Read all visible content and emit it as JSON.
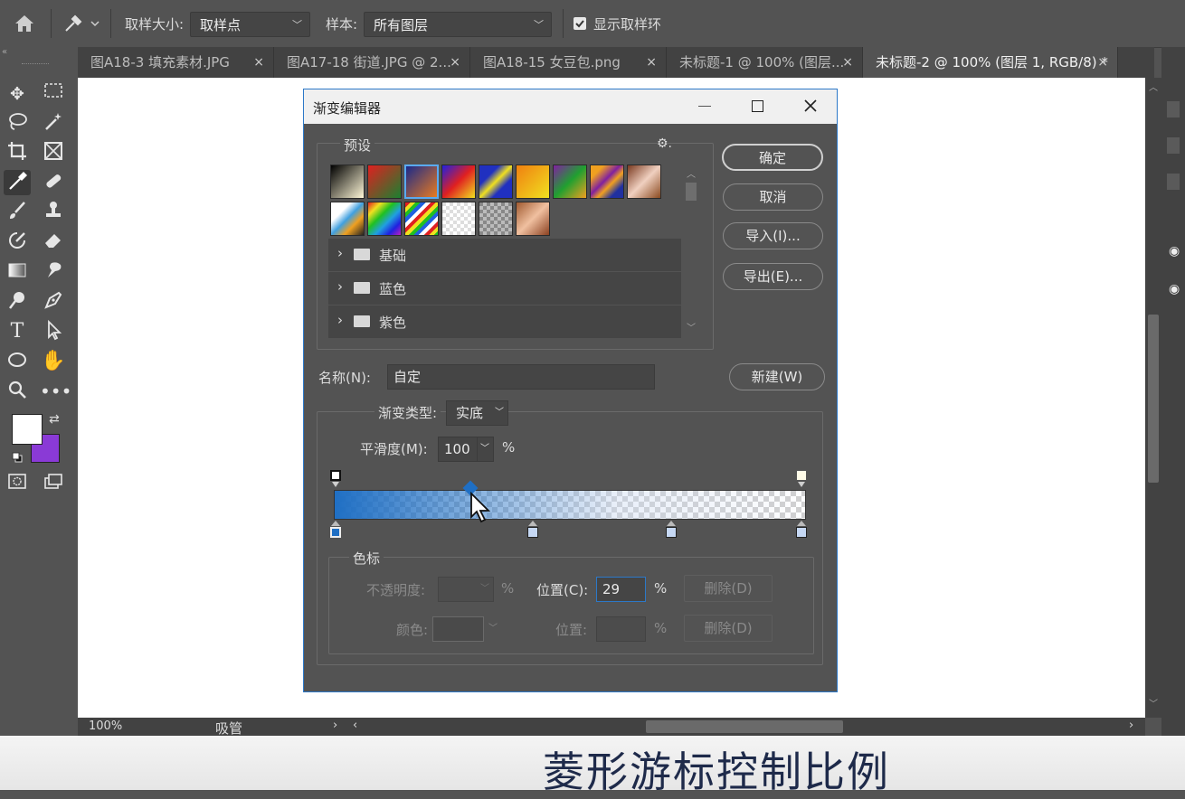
{
  "options_bar": {
    "sample_size_label": "取样大小:",
    "sample_size_value": "取样点",
    "sample_label": "样本:",
    "sample_value": "所有图层",
    "show_ring_label": "显示取样环",
    "show_ring_checked": true
  },
  "tabs": [
    {
      "label": "图A18-3 填充素材.JPG",
      "close": "×"
    },
    {
      "label": "图A17-18 街道.JPG @ 2...",
      "close": "×"
    },
    {
      "label": "图A18-15 女豆包.png",
      "close": "×"
    },
    {
      "label": "未标题-1 @ 100% (图层...",
      "close": "×"
    },
    {
      "label": "未标题-2 @ 100% (图层 1, RGB/8) *",
      "close": "×",
      "active": true
    }
  ],
  "toolbar_icons": [
    "move-icon",
    "marquee-icon",
    "lasso-icon",
    "magic-wand-icon",
    "crop-icon",
    "frame-icon",
    "eyedropper-icon",
    "healing-icon",
    "brush-icon",
    "stamp-icon",
    "history-brush-icon",
    "eraser-icon",
    "gradient-icon",
    "smudge-icon",
    "dodge-icon",
    "pen-icon",
    "type-icon",
    "path-select-icon",
    "ellipse-icon",
    "hand-icon",
    "zoom-icon",
    "more-icon"
  ],
  "colors": {
    "foreground": "#ffffff",
    "background": "#8a3ad6",
    "accent": "#2c78c8",
    "gradient_start": "#1f6fc4"
  },
  "dialog": {
    "title": "渐变编辑器",
    "presets_label": "预设",
    "folders": [
      "基础",
      "蓝色",
      "紫色"
    ],
    "buttons": {
      "ok": "确定",
      "cancel": "取消",
      "import": "导入(I)...",
      "export": "导出(E)...",
      "new": "新建(W)"
    },
    "name_label": "名称(N):",
    "name_value": "自定",
    "type_label": "渐变类型:",
    "type_value": "实底",
    "smooth_label": "平滑度(M):",
    "smooth_value": "100",
    "percent": "%",
    "stops_section_label": "色标",
    "opacity_label": "不透明度:",
    "position_c_label": "位置(C):",
    "position_c_value": "29",
    "delete_label": "删除(D)",
    "color_label": "颜色:",
    "position_label": "位置:",
    "color_stop_positions_percent": [
      0,
      42,
      72,
      100
    ],
    "midpoint_percent": 29
  },
  "status": {
    "zoom": "100%",
    "tool": "吸管"
  },
  "caption": "菱形游标控制比例"
}
